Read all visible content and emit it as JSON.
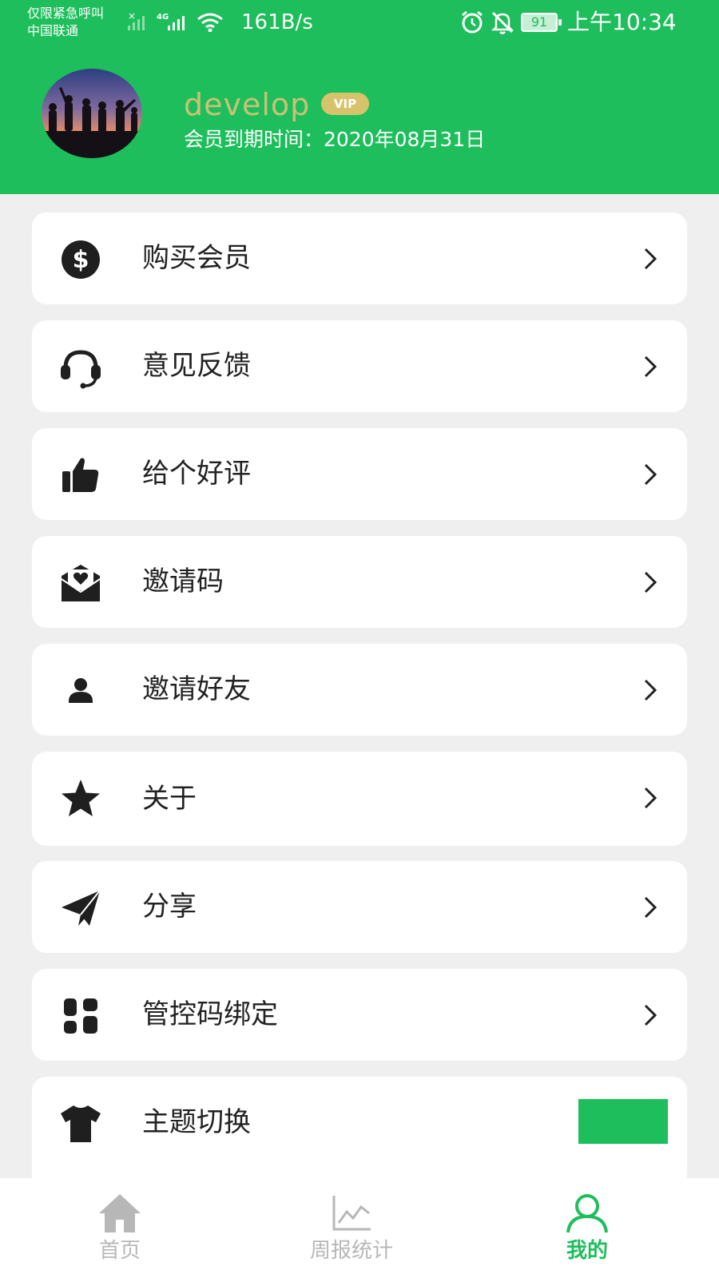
{
  "status_bar": {
    "emergency_text": "仅限紧急呼叫",
    "carrier": "中国联通",
    "network_type": "4G",
    "net_speed": "161B/s",
    "battery_level": "91",
    "time": "上午10:34"
  },
  "profile": {
    "username": "develop",
    "vip_badge": "VIP",
    "expire_text": "会员到期时间：2020年08月31日"
  },
  "menu": {
    "items": [
      {
        "label": "购买会员",
        "icon": "dollar-coin-icon"
      },
      {
        "label": "意见反馈",
        "icon": "headset-icon"
      },
      {
        "label": "给个好评",
        "icon": "thumbs-up-icon"
      },
      {
        "label": "邀请码",
        "icon": "envelope-heart-icon"
      },
      {
        "label": "邀请好友",
        "icon": "user-icon"
      },
      {
        "label": "关于",
        "icon": "star-icon"
      },
      {
        "label": "分享",
        "icon": "paper-plane-icon"
      },
      {
        "label": "管控码绑定",
        "icon": "grid-blocks-icon"
      },
      {
        "label": "主题切换",
        "icon": "t-shirt-icon"
      }
    ]
  },
  "theme": {
    "current_color": "#1dbe5b"
  },
  "tabbar": {
    "tabs": [
      {
        "label": "首页",
        "icon": "home-icon"
      },
      {
        "label": "周报统计",
        "icon": "line-chart-icon"
      },
      {
        "label": "我的",
        "icon": "person-icon"
      }
    ],
    "active_index": 2
  },
  "colors": {
    "brand_green": "#1dbe5b",
    "username_gold": "#c9c275",
    "vip_badge": "#d6c36c",
    "page_background": "#efefef",
    "tab_inactive": "#b7b7b7"
  }
}
